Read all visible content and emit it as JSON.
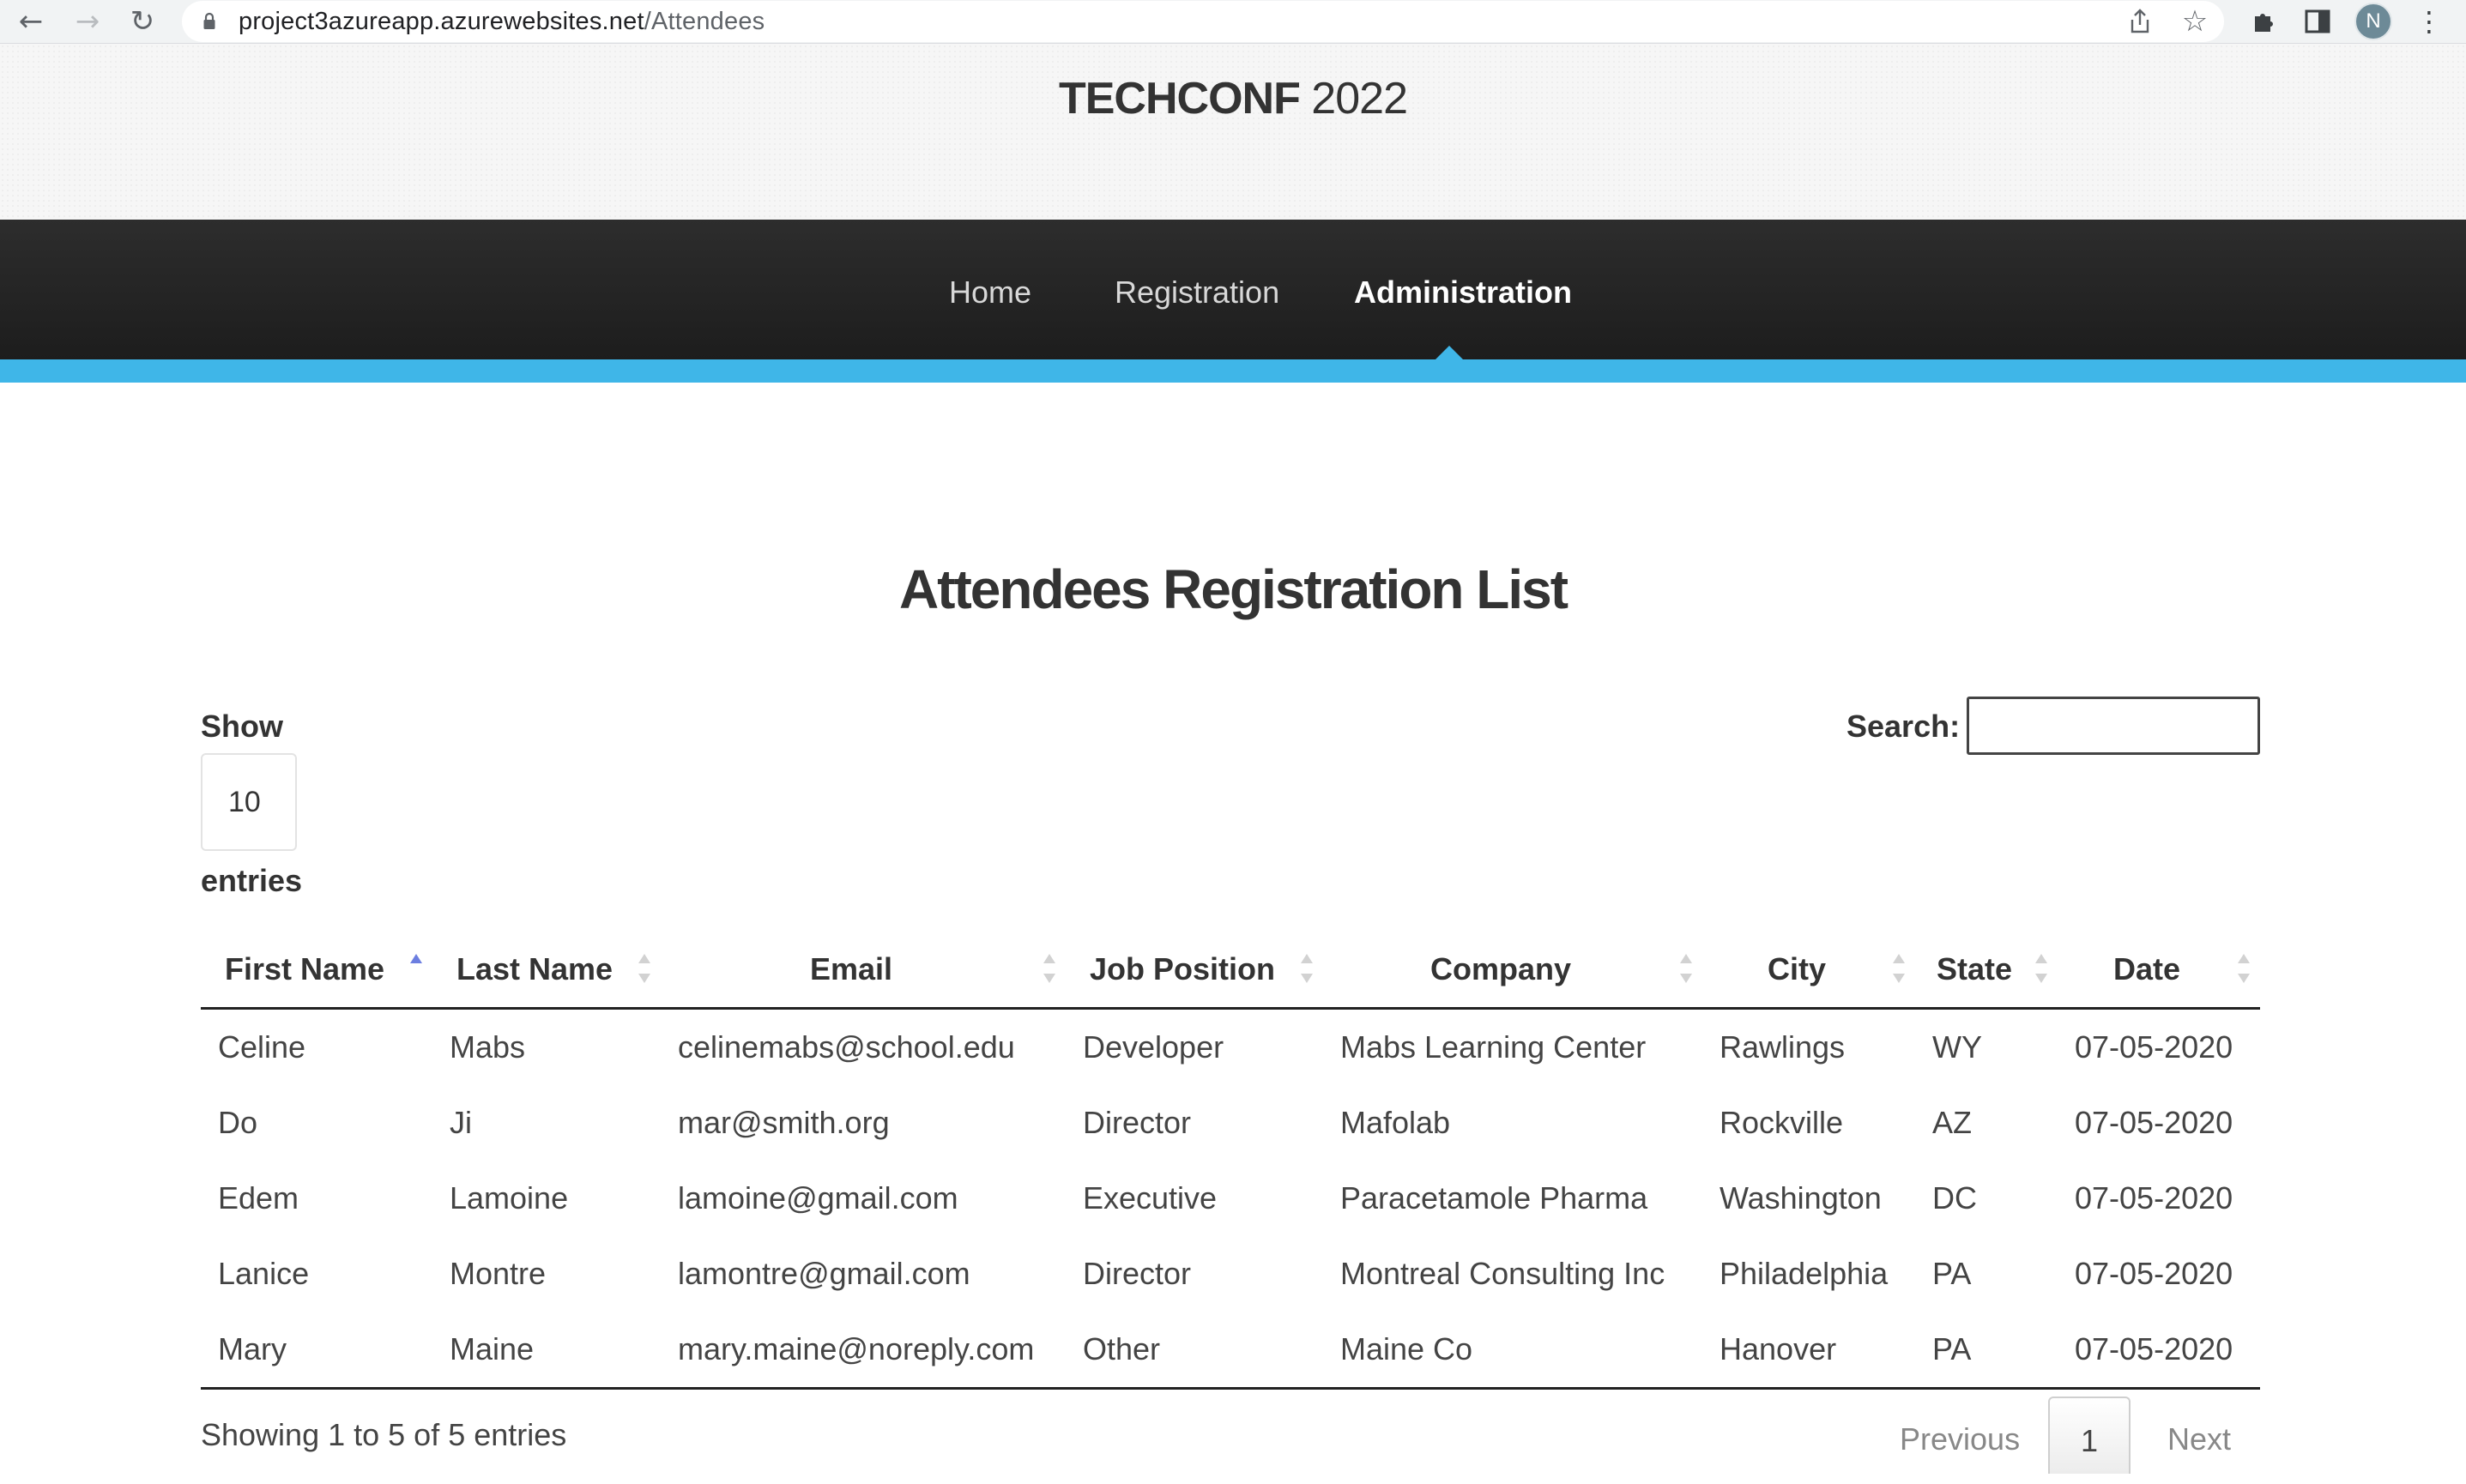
{
  "browser": {
    "url_host": "project3azureapp.azurewebsites.net",
    "url_path": "/Attendees",
    "profile_initial": "N",
    "icons": {
      "back": "back-arrow-icon",
      "forward": "forward-arrow-icon",
      "reload": "reload-icon",
      "lock": "lock-icon",
      "share": "share-icon",
      "bookmark": "star-icon",
      "extensions": "puzzle-icon",
      "sidepanel": "side-panel-icon",
      "menu": "kebab-menu-icon"
    }
  },
  "site": {
    "brand_bold": "TECHCONF",
    "brand_light": " 2022",
    "nav": [
      {
        "label": "Home",
        "active": false
      },
      {
        "label": "Registration",
        "active": false
      },
      {
        "label": "Administration",
        "active": true
      }
    ],
    "accent_color": "#3fb6e8"
  },
  "main": {
    "title": "Attendees Registration List",
    "show_label": "Show",
    "page_length": "10",
    "entries_label": "entries",
    "search_label": "Search:",
    "search_value": ""
  },
  "table": {
    "columns": [
      {
        "label": "First Name",
        "sort": "asc"
      },
      {
        "label": "Last Name",
        "sort": "none"
      },
      {
        "label": "Email",
        "sort": "none"
      },
      {
        "label": "Job Position",
        "sort": "none"
      },
      {
        "label": "Company",
        "sort": "none"
      },
      {
        "label": "City",
        "sort": "none"
      },
      {
        "label": "State",
        "sort": "none"
      },
      {
        "label": "Date",
        "sort": "none"
      }
    ],
    "rows": [
      [
        "Celine",
        "Mabs",
        "celinemabs@school.edu",
        "Developer",
        "Mabs Learning Center",
        "Rawlings",
        "WY",
        "07-05-2020"
      ],
      [
        "Do",
        "Ji",
        "mar@smith.org",
        "Director",
        "Mafolab",
        "Rockville",
        "AZ",
        "07-05-2020"
      ],
      [
        "Edem",
        "Lamoine",
        "lamoine@gmail.com",
        "Executive",
        "Paracetamole Pharma",
        "Washington",
        "DC",
        "07-05-2020"
      ],
      [
        "Lanice",
        "Montre",
        "lamontre@gmail.com",
        "Director",
        "Montreal Consulting Inc",
        "Philadelphia",
        "PA",
        "07-05-2020"
      ],
      [
        "Mary",
        "Maine",
        "mary.maine@noreply.com",
        "Other",
        "Maine Co",
        "Hanover",
        "PA",
        "07-05-2020"
      ]
    ]
  },
  "footer": {
    "info": "Showing 1 to 5 of 5 entries",
    "previous": "Previous",
    "current_page": "1",
    "next": "Next"
  }
}
